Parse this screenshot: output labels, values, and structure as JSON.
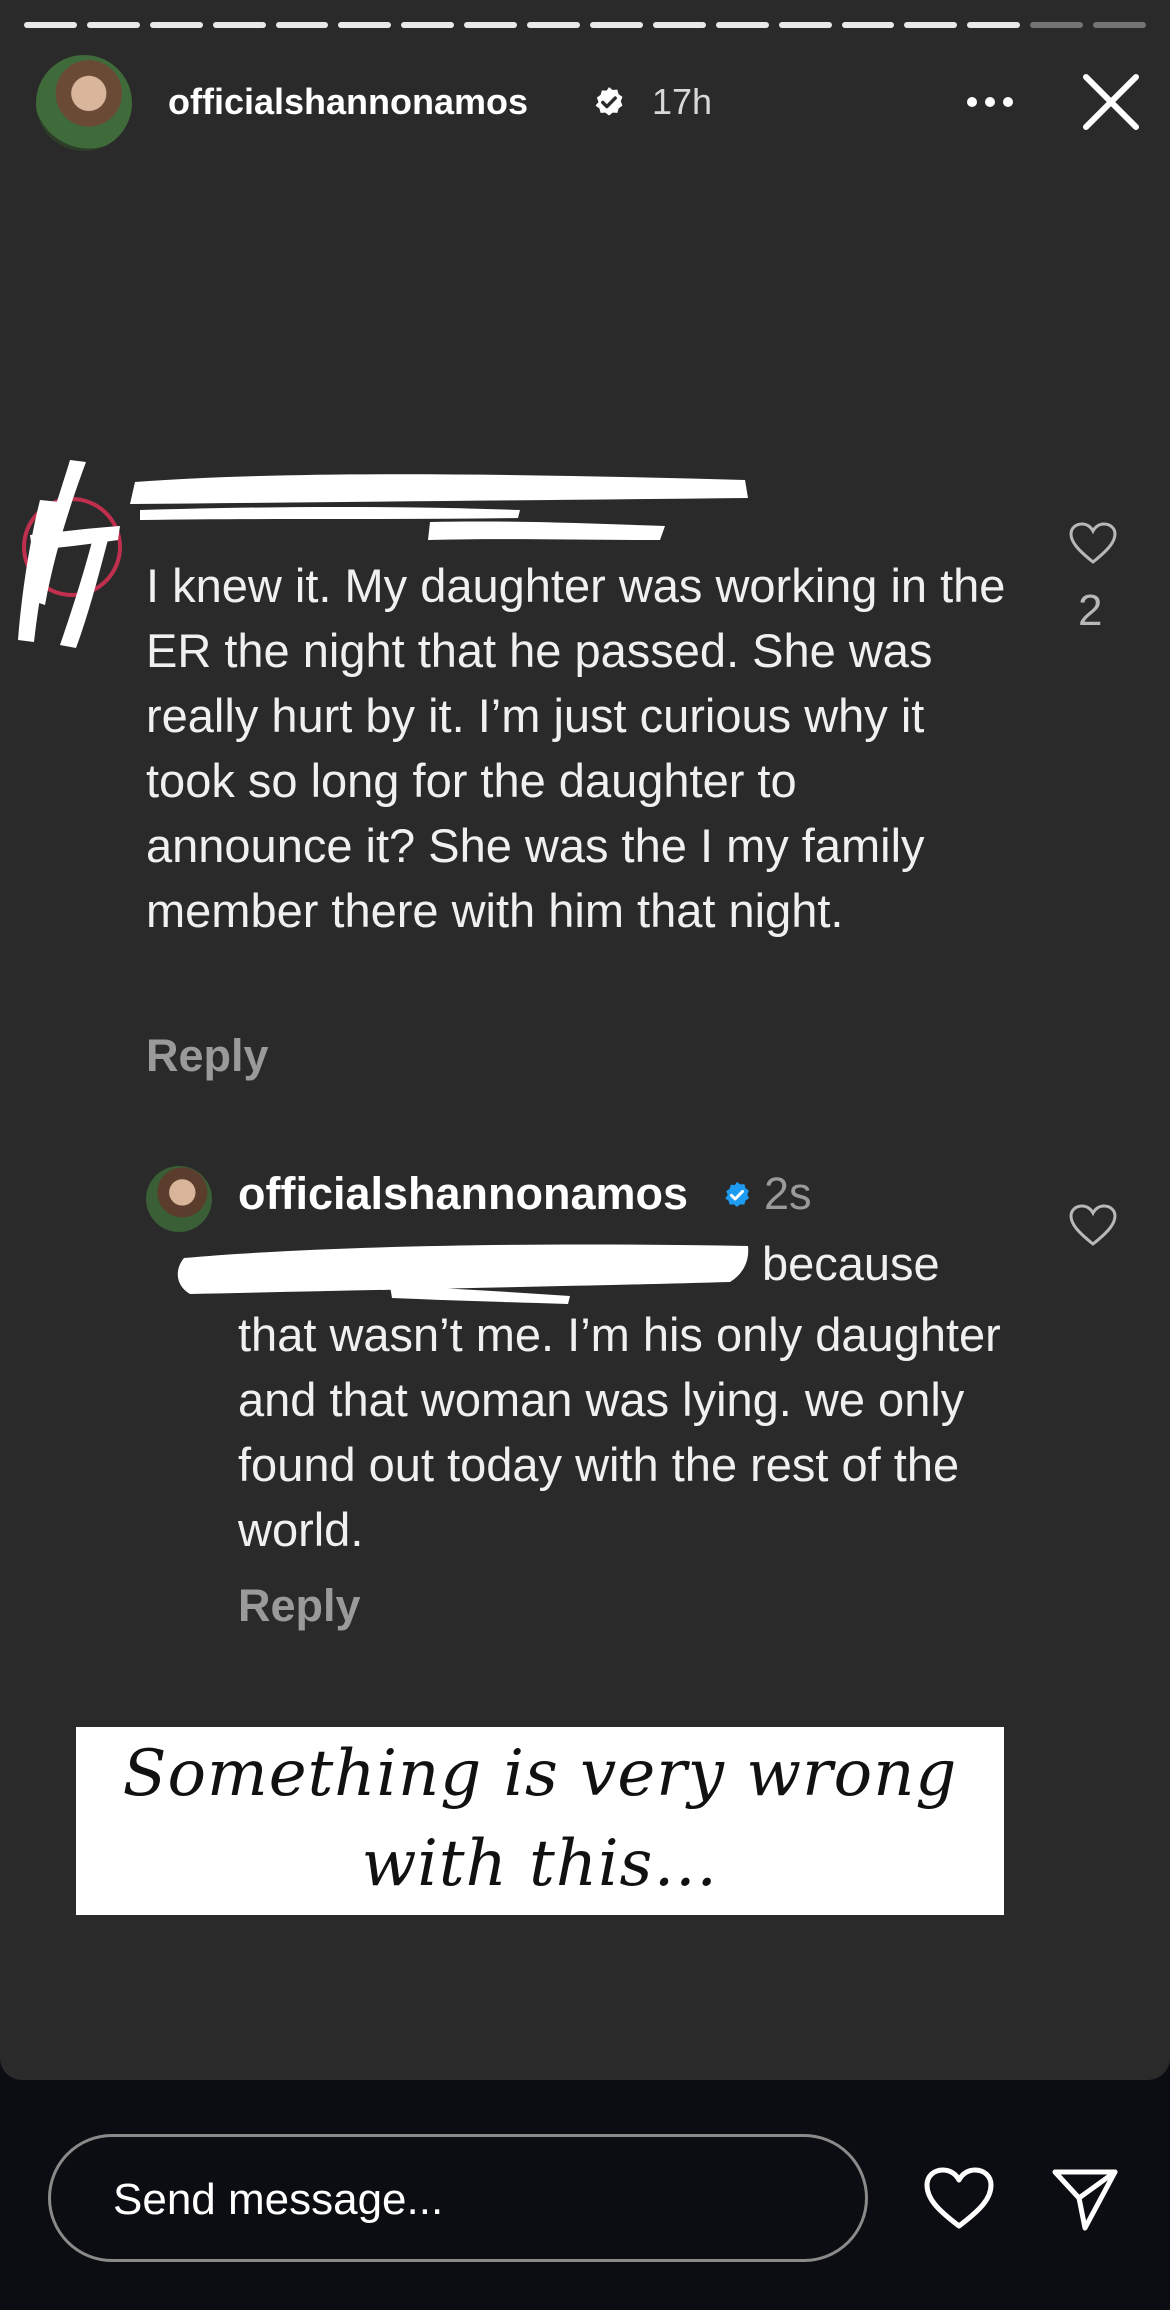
{
  "story": {
    "progress_segments": 18,
    "progress_done": 16,
    "username": "officialshannonamos",
    "time": "17h"
  },
  "comment": {
    "text": "I knew it. My daughter was working in the ER the night that he passed. She was really hurt by it. I’m just curious why it took so long for the daughter to announce it? She was the I my family member there with him that night.",
    "likes": "2",
    "reply_label": "Reply"
  },
  "reply": {
    "username": "officialshannonamos",
    "time": "2s",
    "text_first": "because",
    "text": "that wasn’t me. I’m his only daughter and that woman was lying. we only found out today with the rest of the world.",
    "reply_label": "Reply"
  },
  "overlay": {
    "text": "Something is very wrong with this…"
  },
  "footer": {
    "message_placeholder": "Send message..."
  },
  "colors": {
    "verified_badge": "#1d9bf0",
    "story_bg": "#2a2a2a",
    "page_bg": "#0b0d12"
  },
  "icons": [
    "verified-icon",
    "more-icon",
    "close-icon",
    "heart-icon",
    "send-icon"
  ]
}
